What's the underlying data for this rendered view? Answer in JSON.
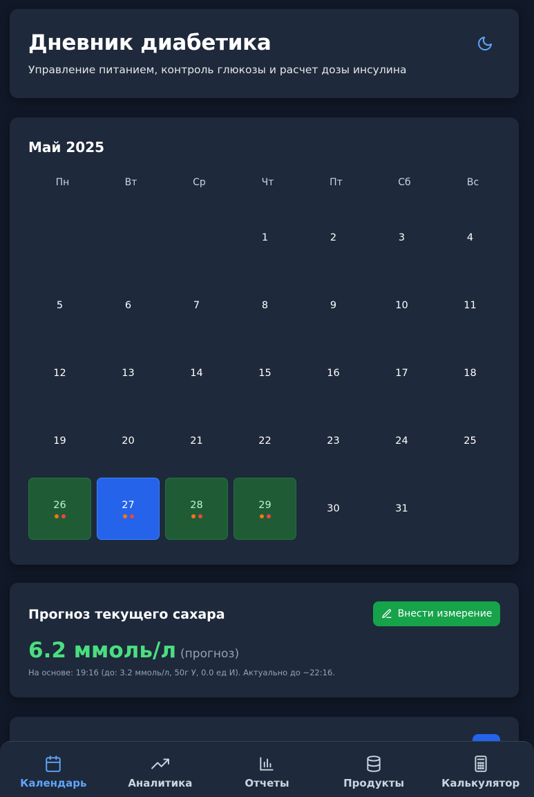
{
  "header": {
    "title": "Дневник диабетика",
    "subtitle": "Управление питанием, контроль глюкозы и расчет дозы инсулина",
    "theme_icon": "moon-icon"
  },
  "calendar": {
    "month_label": "Май 2025",
    "weekdays": [
      "Пн",
      "Вт",
      "Ср",
      "Чт",
      "Пт",
      "Сб",
      "Вс"
    ],
    "leading_empty_days": 3,
    "days": [
      {
        "n": "1"
      },
      {
        "n": "2"
      },
      {
        "n": "3"
      },
      {
        "n": "4"
      },
      {
        "n": "5"
      },
      {
        "n": "6"
      },
      {
        "n": "7"
      },
      {
        "n": "8"
      },
      {
        "n": "9"
      },
      {
        "n": "10"
      },
      {
        "n": "11"
      },
      {
        "n": "12"
      },
      {
        "n": "13"
      },
      {
        "n": "14"
      },
      {
        "n": "15"
      },
      {
        "n": "16"
      },
      {
        "n": "17"
      },
      {
        "n": "18"
      },
      {
        "n": "19"
      },
      {
        "n": "20"
      },
      {
        "n": "21"
      },
      {
        "n": "22"
      },
      {
        "n": "23"
      },
      {
        "n": "24"
      },
      {
        "n": "25"
      },
      {
        "n": "26",
        "state": "has-data",
        "dots": [
          "#f97316",
          "#ef4444"
        ]
      },
      {
        "n": "27",
        "state": "selected",
        "dots": [
          "#f97316",
          "#ef4444"
        ]
      },
      {
        "n": "28",
        "state": "has-data",
        "dots": [
          "#f97316",
          "#ef4444"
        ]
      },
      {
        "n": "29",
        "state": "has-data",
        "dots": [
          "#f97316",
          "#ef4444"
        ]
      },
      {
        "n": "30"
      },
      {
        "n": "31"
      }
    ]
  },
  "forecast": {
    "title": "Прогноз текущего сахара",
    "button_label": "Внести измерение",
    "value": "6.2 ммоль/л",
    "value_note": "(прогноз)",
    "basis": "На основе: 19:16 (до: 3.2 ммоль/л, 50г У, 0.0 ед И). Актуально до ~22:16."
  },
  "nav": {
    "items": [
      {
        "label": "Календарь",
        "icon": "calendar-icon",
        "active": true
      },
      {
        "label": "Аналитика",
        "icon": "trending-up-icon",
        "active": false
      },
      {
        "label": "Отчеты",
        "icon": "bar-chart-icon",
        "active": false
      },
      {
        "label": "Продукты",
        "icon": "database-icon",
        "active": false
      },
      {
        "label": "Калькулятор",
        "icon": "calculator-icon",
        "active": false
      }
    ]
  },
  "colors": {
    "accent": "#60a5fa",
    "success": "#16a34a",
    "sugar_value": "#4ade80",
    "selected_day": "#2563eb",
    "data_day": "#1f5c36"
  }
}
